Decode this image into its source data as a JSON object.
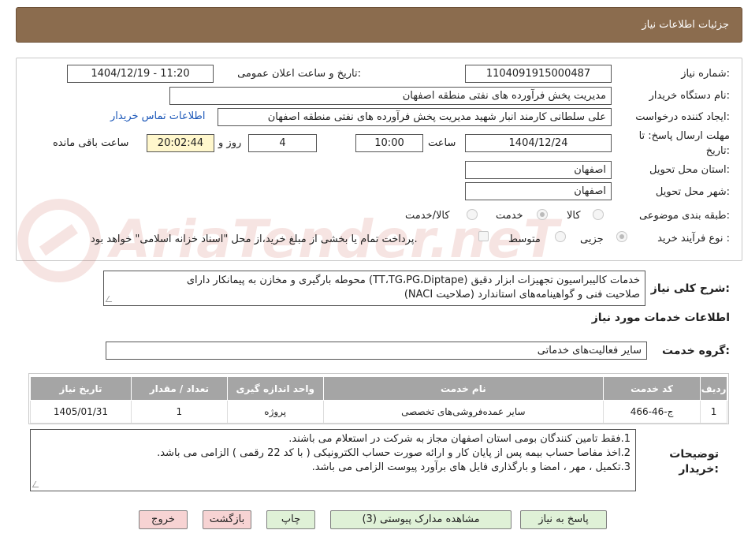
{
  "header": {
    "title": "جزئیات اطلاعات نیاز"
  },
  "fields": {
    "need_number_label": "شماره نیاز:",
    "need_number": "1104091915000487",
    "announce_label": "تاریخ و ساعت اعلان عمومی:",
    "announce_value": "1404/12/19 - 11:20",
    "buyer_org_label": "نام دستگاه خریدار:",
    "buyer_org": "مدیریت پخش فرآورده های نفتی منطقه اصفهان",
    "requester_label": "ایجاد کننده درخواست:",
    "requester": "علی سلطانی کارمند انبار شهید مدیریت پخش فرآورده های نفتی منطقه اصفهان",
    "contact_link": "اطلاعات تماس خریدار",
    "deadline_label_1": "مهلت ارسال پاسخ: تا",
    "deadline_label_2": "تاریخ:",
    "deadline_date": "1404/12/24",
    "time_label": "ساعت",
    "deadline_time": "10:00",
    "days_value": "4",
    "days_label": "روز و",
    "remaining_time": "20:02:44",
    "remaining_label": "ساعت باقی مانده",
    "province_label": "استان محل تحویل:",
    "province": "اصفهان",
    "city_label": "شهر محل تحویل:",
    "city": "اصفهان",
    "category_label": "طبقه بندی موضوعی:",
    "category_options": [
      "کالا",
      "خدمت",
      "کالا/خدمت"
    ],
    "category_selected": "خدمت",
    "process_label": "نوع فرآیند خرید :",
    "process_options": [
      "جزیی",
      "متوسط"
    ],
    "process_selected": "جزیی",
    "payment_note": "پرداخت تمام یا بخشی از مبلغ خرید،از محل \"اسناد خزانه اسلامی\" خواهد بود."
  },
  "description": {
    "label": "شرح کلی نیاز:",
    "line1": "خدمات کالیبراسیون تجهیزات ابزار دقیق (TT،TG،PG،Diptape)  محوطه بارگیری و مخازن به پیمانکار دارای",
    "line2": "صلاحیت فنی و گواهینامه‌های استاندارد (صلاحیت NACI)"
  },
  "services": {
    "section_title": "اطلاعات خدمات مورد نیاز",
    "group_label": "گروه خدمت:",
    "group_value": "سایر فعالیت‌های خدماتی",
    "columns": [
      "ردیف",
      "کد خدمت",
      "نام خدمت",
      "واحد اندازه گیری",
      "تعداد / مقدار",
      "تاریخ نیاز"
    ],
    "rows": [
      {
        "row": "1",
        "code": "ج-46-466",
        "name": "سایر عمده‌فروشی‌های تخصصی",
        "unit": "پروژه",
        "qty": "1",
        "date": "1405/01/31"
      }
    ]
  },
  "notes": {
    "label_1": "توضیحات",
    "label_2": "خریدار:",
    "line1": "1.فقط تامین کنندگان بومی استان اصفهان مجاز به شرکت در استعلام می باشند.",
    "line2": "2.اخذ مفاصا حساب بیمه پس از پایان کار و ارائه صورت حساب الکترونیکی ( با کد 22 رقمی ) الزامی می باشد.",
    "line3": "3.تکمیل ،  مهر ،  امضا و بارگذاری فایل های برآورد پیوست الزامی می باشد."
  },
  "buttons": {
    "reply": "پاسخ به نیاز",
    "attachments": "مشاهده مدارک پیوستی (3)",
    "print": "چاپ",
    "back": "بازگشت",
    "exit": "خروج"
  },
  "watermark_text": "AriaTender.neT",
  "colors": {
    "header_bg": "#8b6c4e",
    "table_header": "#a5a5a5",
    "link": "#1a56b8",
    "remaining_bg": "#fff7cc"
  }
}
